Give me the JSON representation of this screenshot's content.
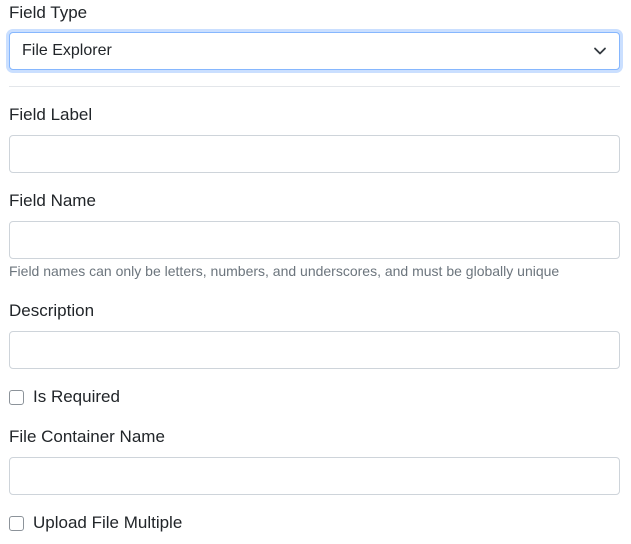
{
  "field_type": {
    "label": "Field Type",
    "selected": "File Explorer"
  },
  "field_label": {
    "label": "Field Label",
    "value": ""
  },
  "field_name": {
    "label": "Field Name",
    "value": "",
    "help": "Field names can only be letters, numbers, and underscores, and must be globally unique"
  },
  "description": {
    "label": "Description",
    "value": ""
  },
  "is_required": {
    "label": "Is Required",
    "checked": false
  },
  "file_container_name": {
    "label": "File Container Name",
    "value": ""
  },
  "upload_file_multiple": {
    "label": "Upload File Multiple",
    "checked": false
  },
  "colors": {
    "focus_border": "#86b7fe",
    "input_border": "#ced4da",
    "help_text": "#6c757d"
  }
}
